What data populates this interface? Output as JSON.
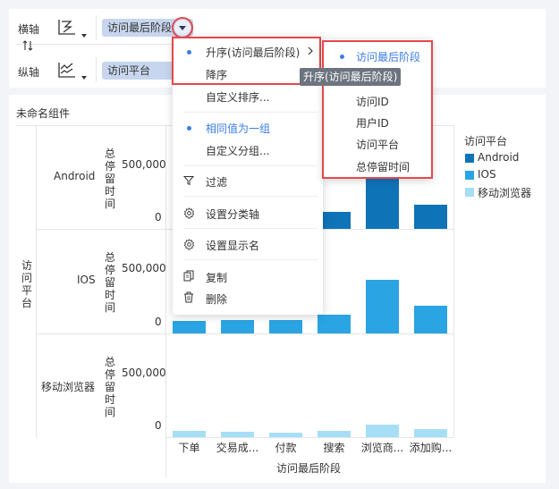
{
  "axis": {
    "x_label": "横轴",
    "y_label": "纵轴",
    "x_field": "访问最后阶段",
    "y_field": "访问平台"
  },
  "widget": {
    "title": "未命名组件"
  },
  "sort_menu": {
    "items": [
      {
        "label": "升序(访问最后阶段)",
        "selected": true,
        "has_submenu": true
      },
      {
        "label": "降序",
        "selected": false
      },
      {
        "label": "自定义排序...",
        "selected": false
      },
      {
        "label": "相同值为一组",
        "selected": true
      },
      {
        "label": "自定义分组...",
        "selected": false
      },
      {
        "label": "过滤",
        "icon": "filter-icon"
      },
      {
        "label": "设置分类轴",
        "icon": "gear-icon"
      },
      {
        "label": "设置显示名",
        "icon": "gear-icon"
      },
      {
        "label": "复制",
        "icon": "copy-icon"
      },
      {
        "label": "删除",
        "icon": "trash-icon"
      }
    ]
  },
  "submenu": {
    "items": [
      {
        "label": "访问最后阶段",
        "selected": true
      },
      {
        "label": "访问ID",
        "selected": false
      },
      {
        "label": "用户ID",
        "selected": false
      },
      {
        "label": "访问平台",
        "selected": false
      },
      {
        "label": "总停留时间",
        "selected": false
      }
    ]
  },
  "tooltip": "升序(访问最后阶段)",
  "chart_data": {
    "type": "bar",
    "categories": [
      "下单",
      "交易成...",
      "付款",
      "搜索",
      "浏览商...",
      "添加购..."
    ],
    "xlabel": "访问最后阶段",
    "facet_label": "访问平台",
    "ylabel": "总停留时间",
    "y_ticks": [
      "0",
      "500,000"
    ],
    "ylim": [
      0,
      1000000
    ],
    "legend_title": "访问平台",
    "series": [
      {
        "name": "Android",
        "color": "#0f73b8",
        "values": [
          null,
          null,
          null,
          160000,
          490000,
          230000
        ]
      },
      {
        "name": "IOS",
        "color": "#2aa4e3",
        "values": [
          120000,
          130000,
          130000,
          180000,
          520000,
          270000
        ]
      },
      {
        "name": "移动浏览器",
        "color": "#a6def6",
        "values": [
          60000,
          50000,
          40000,
          60000,
          120000,
          80000
        ]
      }
    ]
  }
}
